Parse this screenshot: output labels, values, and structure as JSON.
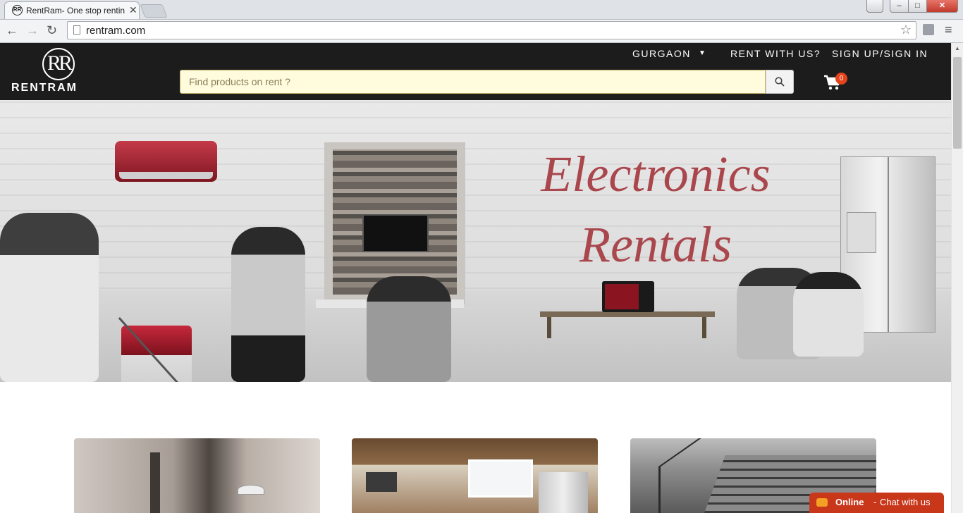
{
  "browser": {
    "tab_title": "RentRam- One stop rentin",
    "tab_close": "✕",
    "url": "rentram.com",
    "back_icon": "←",
    "forward_icon": "→",
    "reload_icon": "↻",
    "star_icon": "☆",
    "menu_icon": "≡",
    "window_min": "–",
    "window_max": "□",
    "window_close": "✕"
  },
  "header": {
    "logo_text": "RENTRAM",
    "logo_mark": "RR",
    "city": "GURGAON",
    "city_caret": "▼",
    "rent_with_us": "RENT WITH US?",
    "sign_in": "SIGN UP/SIGN IN",
    "search_placeholder": "Find products on rent ?",
    "cart_count": "0"
  },
  "hero": {
    "title_line1": "Electronics",
    "title_line2": "Rentals"
  },
  "chat": {
    "status": "Online",
    "separator": "-",
    "message": "Chat with us"
  },
  "colors": {
    "header_bg": "#1c1c1c",
    "hero_title": "#a9474d",
    "badge": "#e5431c",
    "chat_bg": "#c9371b",
    "search_bg": "#fffbdd"
  },
  "icons": {
    "search": "search-icon",
    "cart": "cart-icon",
    "chat": "chat-bubble-icon",
    "star": "bookmark-star-icon"
  }
}
